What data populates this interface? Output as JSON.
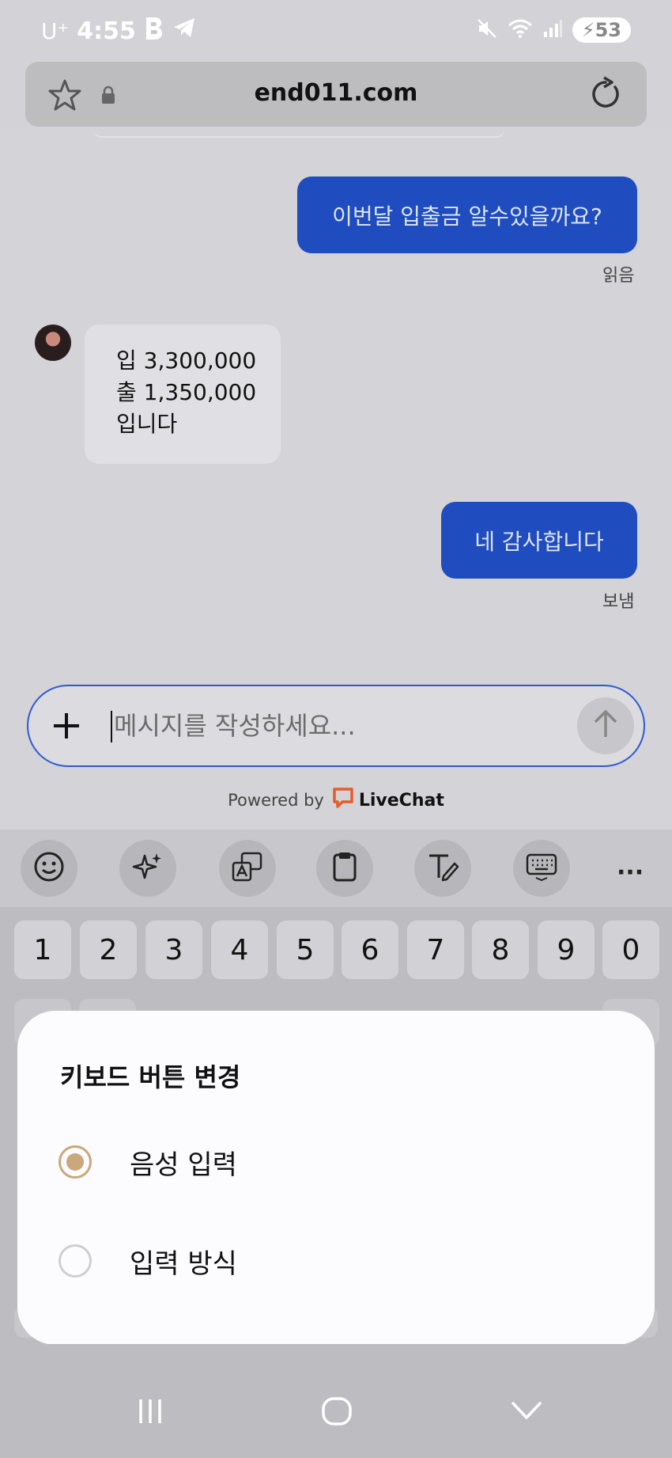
{
  "status_bar": {
    "carrier": "U⁺",
    "time": "4:55",
    "battery": "53"
  },
  "browser": {
    "url": "end011.com",
    "icons": [
      "star-icon",
      "lock-icon",
      "reload-icon"
    ]
  },
  "chat": {
    "messages": [
      {
        "direction": "out",
        "text": "이번달 입출금 알수있을까요?",
        "status": "읽음"
      },
      {
        "direction": "in",
        "lines": [
          "입 3,300,000",
          "출 1,350,000",
          "입니다"
        ]
      },
      {
        "direction": "out",
        "text": "네 감사합니다",
        "status": "보냄"
      }
    ]
  },
  "composer": {
    "placeholder": "메시지를 작성하세요...",
    "powered_by": "Powered by",
    "brand": "LiveChat"
  },
  "keyboard": {
    "toolbar_icons": [
      "emoji-icon",
      "ai-sparkle-icon",
      "translate-icon",
      "clipboard-icon",
      "handwriting-icon",
      "keyboard-icon",
      "more-icon"
    ],
    "number_keys": [
      "1",
      "2",
      "3",
      "4",
      "5",
      "6",
      "7",
      "8",
      "9",
      "0"
    ],
    "more_glyph": "···"
  },
  "dialog": {
    "title": "키보드 버튼 변경",
    "options": [
      {
        "label": "음성 입력",
        "selected": true
      },
      {
        "label": "입력 방식",
        "selected": false
      }
    ]
  },
  "colors": {
    "accent_blue": "#1f4dbf",
    "radio_selected": "#c9a87c",
    "livechat_orange": "#e35d2a"
  }
}
